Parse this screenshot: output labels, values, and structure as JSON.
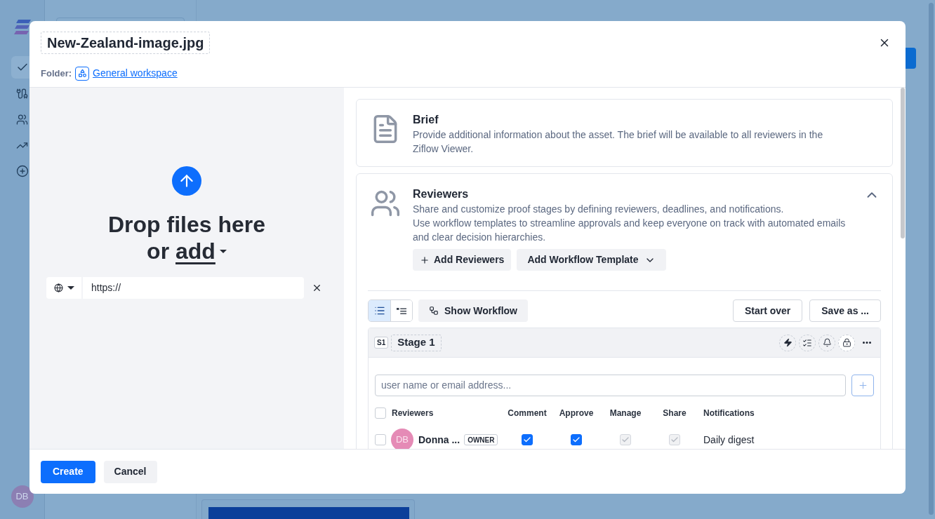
{
  "background": {
    "nav_items": [
      {
        "kind": "check",
        "selected": true
      },
      {
        "kind": "cable",
        "selected": false
      },
      {
        "kind": "users",
        "selected": false
      },
      {
        "kind": "trend",
        "selected": false
      },
      {
        "kind": "add",
        "selected": false
      }
    ],
    "avatar": "DB"
  },
  "dialog": {
    "title": "New-Zealand-image.jpg",
    "folder_label": "Folder:",
    "folder_link": "General workspace"
  },
  "upload": {
    "heading": "Drop files here or",
    "add_link": "add",
    "url_value": "https://"
  },
  "brief": {
    "title": "Brief",
    "description": "Provide additional information about the asset. The brief will be available to all reviewers in the Ziflow Viewer."
  },
  "reviewers": {
    "title": "Reviewers",
    "expanded": true,
    "description": [
      "Share and customize proof stages by defining reviewers, deadlines, and notifications.",
      "Use workflow templates to streamline approvals and keep everyone on track with automated emails and clear decision hierarchies."
    ],
    "buttons": [
      {
        "kind": "add",
        "label": "Add Reviewers"
      },
      {
        "kind": "dropdown",
        "label": "Add Workflow Template"
      }
    ]
  },
  "workflow": {
    "view_modes": [
      {
        "kind": "list",
        "selected": true
      },
      {
        "kind": "outline",
        "selected": false
      }
    ],
    "show_workflow": "Show Workflow",
    "actions": [
      "Start over",
      "Save as ..."
    ]
  },
  "stage": {
    "badge": "S1",
    "name": "Stage 1",
    "input_placeholder": "user name or email address...",
    "columns": [
      "Reviewers",
      "Comment",
      "Approve",
      "Manage",
      "Share",
      "Notifications"
    ],
    "select_all": false,
    "rows": [
      {
        "initials": "DB",
        "name": "Donna ...",
        "badge": "OWNER",
        "selected": false,
        "comment": {
          "checked": true,
          "disabled": false
        },
        "approve": {
          "checked": true,
          "disabled": false
        },
        "manage": {
          "checked": true,
          "disabled": true
        },
        "share": {
          "checked": true,
          "disabled": true
        },
        "notifications": "Daily digest"
      }
    ]
  },
  "footer": {
    "buttons": [
      {
        "kind": "primary",
        "label": "Create"
      },
      {
        "kind": "secondary",
        "label": "Cancel"
      }
    ]
  }
}
